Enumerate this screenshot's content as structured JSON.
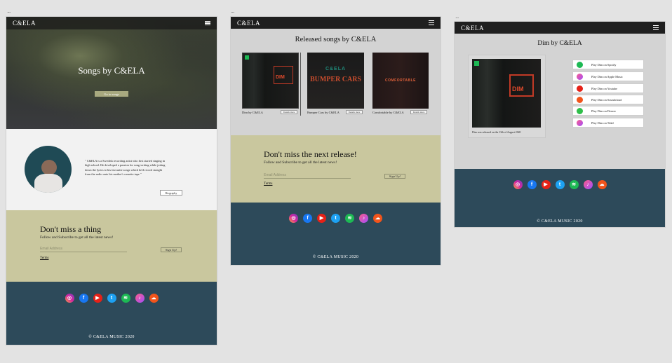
{
  "frames": {
    "dots": "..."
  },
  "brand": "C&ELA",
  "home": {
    "hero_title": "Songs by C&ELA",
    "hero_button": "Go to songs",
    "bio": "\" C&ELA is a Swedish recording artist who first started singing in high school. He developed a passion for song writing while jotting down the lyrics to his favourite songs which he'd record straight from the radio onto his mother's cassette tape \"",
    "biography_button": "Biography",
    "newsletter_title": "Don't miss a thing",
    "newsletter_subtitle": "Follow and Subscribe to get all the latest news!",
    "email_placeholder": "Email Address",
    "signup": "Sign Up!",
    "terms": "Terms"
  },
  "songs_page": {
    "title": "Released songs by C&ELA",
    "songs": [
      {
        "caption": "Dim by C&ELA",
        "details": "Details Here",
        "cover_text": "DIM"
      },
      {
        "caption": "Bumper Cars by C&ELA",
        "details": "Details Here",
        "cover_text": "C&ELA",
        "cover_text2": "BUMPER CARS"
      },
      {
        "caption": "Comfortable by C&ELA",
        "details": "Details Here",
        "cover_text": "COMFORTABLE"
      }
    ],
    "newsletter_title": "Don't miss the next release!",
    "newsletter_subtitle": "Follow and Subscribe to get all the latest news!",
    "email_placeholder": "Email Address",
    "signup": "Sign Up!",
    "terms": "Terms"
  },
  "dim_page": {
    "title": "Dim by C&ELA",
    "cover_text": "DIM",
    "release_note": "Dim was released on the 13th of August 2020",
    "platforms": [
      {
        "label": "Play Dim on Spotify",
        "icon": "spotify-icon",
        "color": "#1db954"
      },
      {
        "label": "Play Dim on Apple Music",
        "icon": "apple-music-icon",
        "color": "#f36"
      },
      {
        "label": "Play Dim on Youtube",
        "icon": "youtube-icon",
        "color": "#e62117"
      },
      {
        "label": "Play Dim on Soundcloud",
        "icon": "soundcloud-icon",
        "color": "#f2541b"
      },
      {
        "label": "Play Dim on Deezer",
        "icon": "deezer-icon",
        "color": "#2fbf4a"
      },
      {
        "label": "Play Dim on Tidal",
        "icon": "tidal-icon",
        "color": "#f36"
      }
    ]
  },
  "social_icons": [
    "instagram-icon",
    "facebook-icon",
    "youtube-icon",
    "twitter-icon",
    "spotify-icon",
    "apple-music-icon",
    "soundcloud-icon"
  ],
  "colors": {
    "nav": "#1f1f1f",
    "footer": "#2d4a5a",
    "newsletter": "#c9c79e",
    "page_bg": "#d3d3d3"
  },
  "footer": {
    "copyright": "© C&ELA MUSIC 2020"
  }
}
